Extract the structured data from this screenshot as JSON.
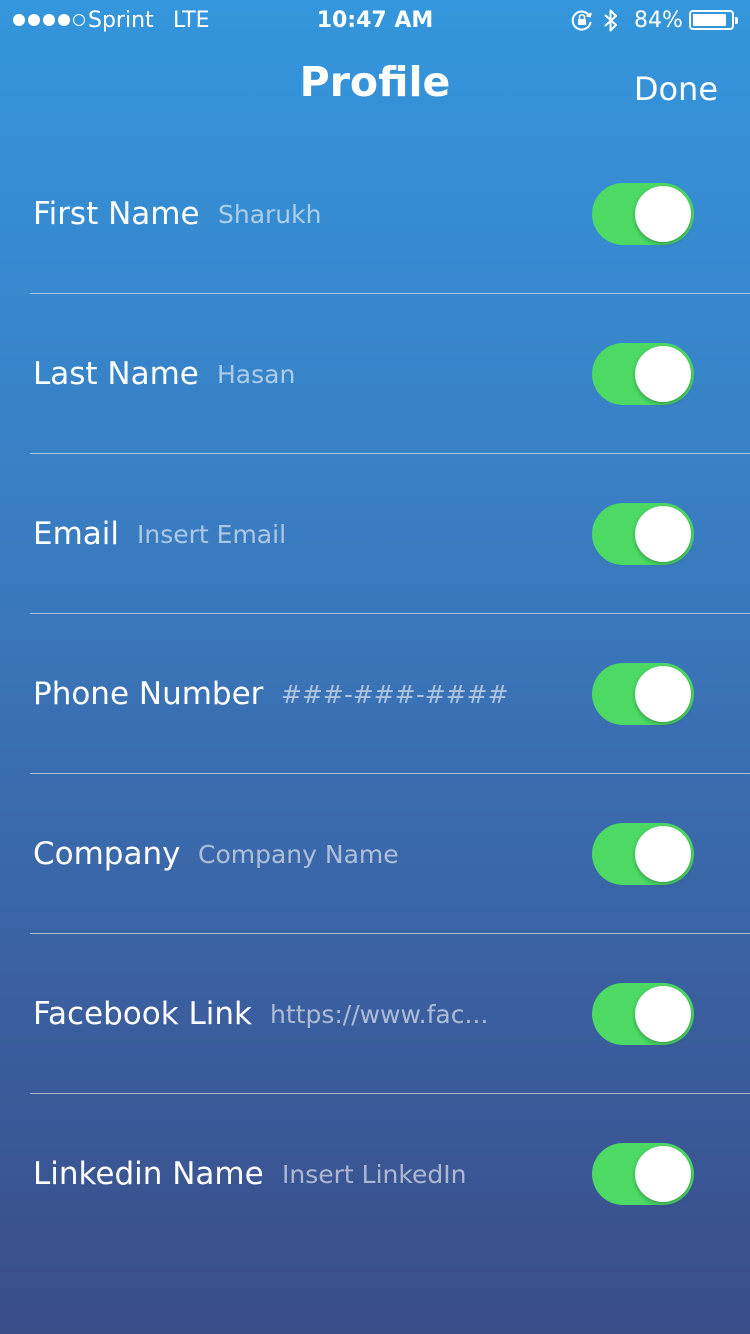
{
  "status_bar": {
    "carrier": "Sprint",
    "network": "LTE",
    "time": "10:47 AM",
    "battery_percent": "84%",
    "signal_strength": 4,
    "signal_max": 5,
    "icons": [
      "rotation-lock-icon",
      "bluetooth-icon",
      "battery-icon"
    ]
  },
  "nav": {
    "title": "Profile",
    "done_label": "Done"
  },
  "colors": {
    "toggle_on": "#4cd964",
    "gradient_top": "#3496dc",
    "gradient_bottom": "#394d89"
  },
  "fields": [
    {
      "label": "First Name",
      "value": "",
      "placeholder": "Sharukh",
      "enabled": true
    },
    {
      "label": "Last Name",
      "value": "",
      "placeholder": "Hasan",
      "enabled": true
    },
    {
      "label": "Email",
      "value": "",
      "placeholder": "Insert Email",
      "enabled": true
    },
    {
      "label": "Phone Number",
      "value": "",
      "placeholder": "###-###-####",
      "enabled": true
    },
    {
      "label": "Company",
      "value": "",
      "placeholder": "Company Name",
      "enabled": true
    },
    {
      "label": "Facebook Link",
      "value": "",
      "placeholder": "https://www.fac...",
      "enabled": true
    },
    {
      "label": "Linkedin Name",
      "value": "",
      "placeholder": "Insert LinkedIn",
      "enabled": true
    }
  ]
}
